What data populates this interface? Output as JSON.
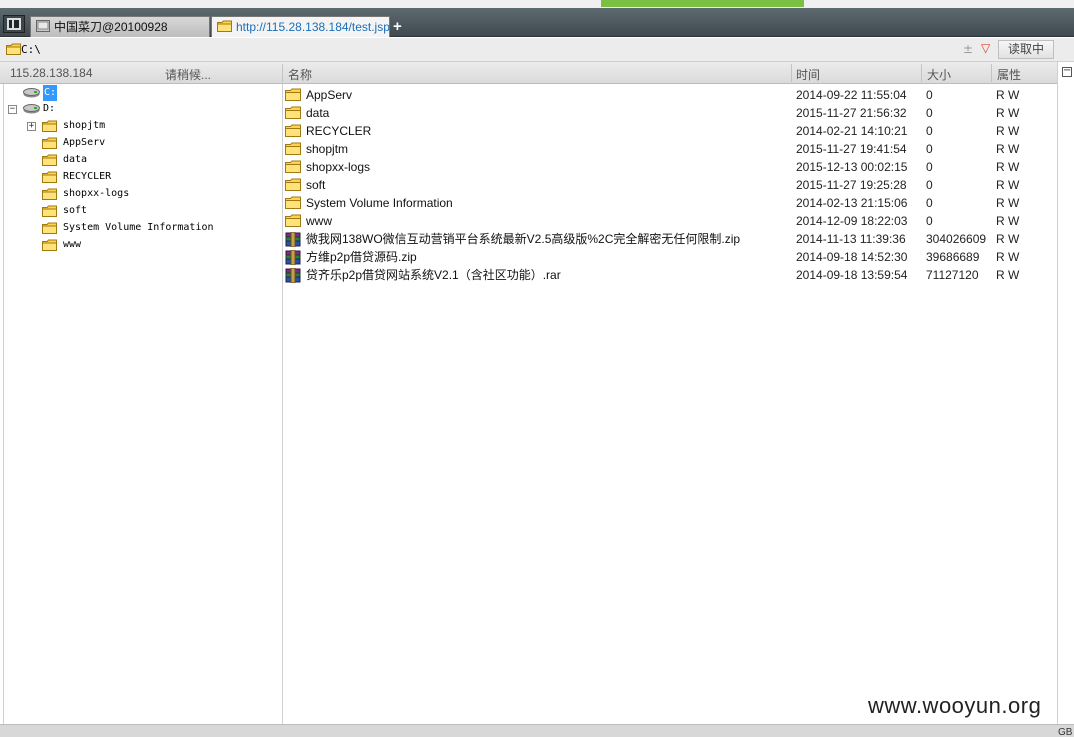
{
  "tabs": [
    {
      "label": "中国菜刀@20100928"
    },
    {
      "label": "http://115.28.138.184/test.jsp"
    }
  ],
  "new_tab_label": "+",
  "address": {
    "value": "C:\\",
    "plus": "±",
    "dropdown": "▽",
    "read_button": "读取中"
  },
  "header": {
    "host": "115.28.138.184",
    "status": "请稍候...",
    "col_name": "名称",
    "col_time": "时间",
    "col_size": "大小",
    "col_attr": "属性"
  },
  "tree": [
    {
      "label": "C:",
      "selected": true
    },
    {
      "label": "D:",
      "expanded": true
    },
    {
      "label": "shopjtm",
      "expander": "+"
    },
    {
      "label": "AppServ"
    },
    {
      "label": "data"
    },
    {
      "label": "RECYCLER"
    },
    {
      "label": "shopxx-logs"
    },
    {
      "label": "soft"
    },
    {
      "label": "System Volume Information"
    },
    {
      "label": "www"
    }
  ],
  "files": [
    {
      "name": "AppServ",
      "time": "2014-09-22 11:55:04",
      "size": "0",
      "attr": "R W",
      "type": "folder"
    },
    {
      "name": "data",
      "time": "2015-11-27 21:56:32",
      "size": "0",
      "attr": "R W",
      "type": "folder"
    },
    {
      "name": "RECYCLER",
      "time": "2014-02-21 14:10:21",
      "size": "0",
      "attr": "R W",
      "type": "folder"
    },
    {
      "name": "shopjtm",
      "time": "2015-11-27 19:41:54",
      "size": "0",
      "attr": "R W",
      "type": "folder"
    },
    {
      "name": "shopxx-logs",
      "time": "2015-12-13 00:02:15",
      "size": "0",
      "attr": "R W",
      "type": "folder"
    },
    {
      "name": "soft",
      "time": "2015-11-27 19:25:28",
      "size": "0",
      "attr": "R W",
      "type": "folder"
    },
    {
      "name": "System Volume Information",
      "time": "2014-02-13 21:15:06",
      "size": "0",
      "attr": "R W",
      "type": "folder"
    },
    {
      "name": "www",
      "time": "2014-12-09 18:22:03",
      "size": "0",
      "attr": "R W",
      "type": "folder"
    },
    {
      "name": "微我网138WO微信互动营销平台系统最新V2.5高级版%2C完全解密无任何限制.zip",
      "time": "2014-11-13 11:39:36",
      "size": "304026609",
      "attr": "R W",
      "type": "archive"
    },
    {
      "name": "方维p2p借贷源码.zip",
      "time": "2014-09-18 14:52:30",
      "size": "39686689",
      "attr": "R W",
      "type": "archive"
    },
    {
      "name": "贷齐乐p2p借贷网站系统V2.1（含社区功能）.rar",
      "time": "2014-09-18 13:59:54",
      "size": "71127120",
      "attr": "R W",
      "type": "archive"
    }
  ],
  "right_gutter": {
    "collapse": "−"
  },
  "status": {
    "encoding": "GB"
  },
  "watermark": "www.wooyun.org",
  "colors": {
    "accent_green": "#7bc043",
    "selection": "#3399ff",
    "tab_link": "#1a6fb9"
  }
}
